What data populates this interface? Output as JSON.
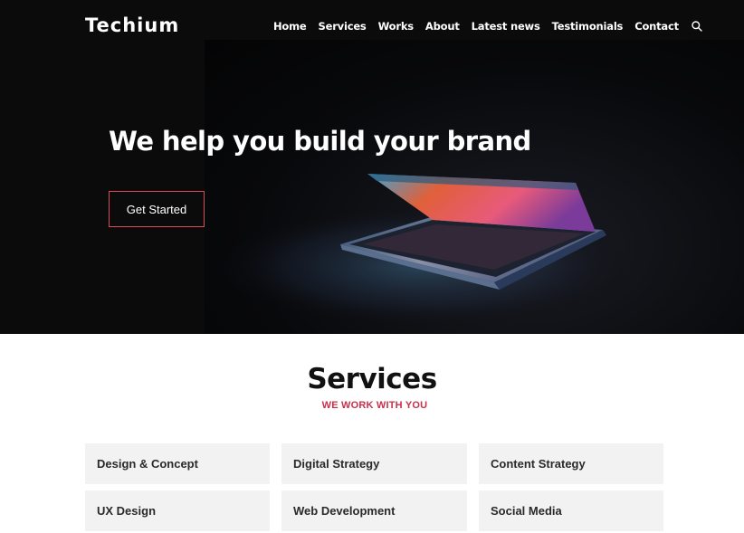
{
  "brand": {
    "logo_text": "Techium"
  },
  "nav": {
    "items": [
      "Home",
      "Services",
      "Works",
      "About",
      "Latest news",
      "Testimonials",
      "Contact"
    ],
    "search_icon": "search-icon"
  },
  "hero": {
    "headline": "We help you build your brand",
    "cta_label": "Get Started",
    "image": "laptop-in-dark-photo"
  },
  "services": {
    "title": "Services",
    "subtitle": "WE WORK WITH YOU",
    "items": [
      "Design & Concept",
      "Digital Strategy",
      "Content Strategy",
      "UX Design",
      "Web Development",
      "Social Media"
    ]
  },
  "colors": {
    "accent": "#c9304a",
    "cta_border": "#d94a5a",
    "hero_bg": "#0b0b0c",
    "card_bg": "#f2f2f2"
  }
}
